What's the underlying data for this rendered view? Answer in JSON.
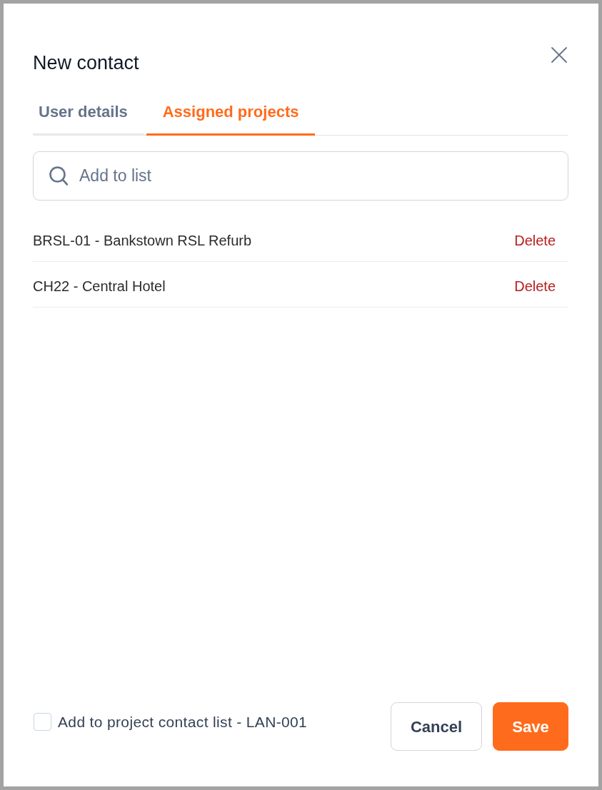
{
  "dialog": {
    "title": "New contact"
  },
  "tabs": [
    {
      "label": "User details",
      "selected": false
    },
    {
      "label": "Assigned projects",
      "selected": true
    }
  ],
  "search": {
    "placeholder": "Add to list"
  },
  "projects": [
    {
      "name": "BRSL-01 - Bankstown RSL Refurb",
      "action": "Delete"
    },
    {
      "name": "CH22 - Central Hotel",
      "action": "Delete"
    }
  ],
  "footer": {
    "checkbox": {
      "label": "Add to project contact list - LAN-001",
      "checked": false
    },
    "buttons": [
      {
        "label": "Cancel",
        "kind": "secondary"
      },
      {
        "label": "Save",
        "kind": "primary"
      }
    ]
  }
}
